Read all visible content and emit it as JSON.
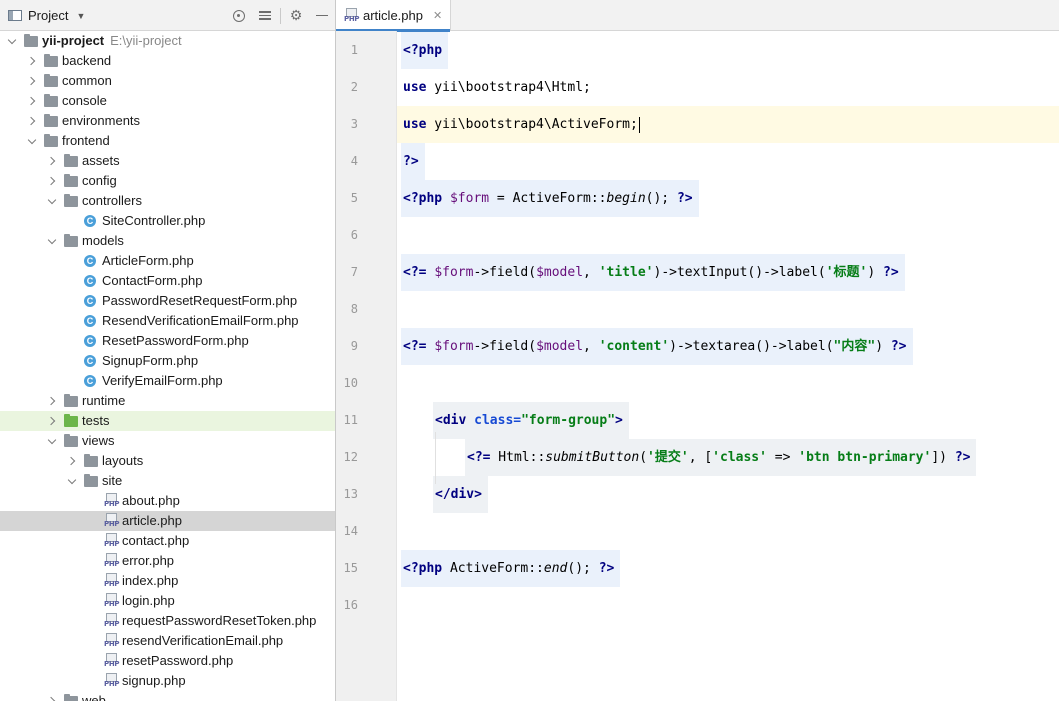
{
  "project_panel": {
    "title": "Project",
    "dropdown_icon": "caret-down-icon",
    "tools": [
      "locate-target-icon",
      "collapse-all-icon",
      "settings-icon",
      "minimize-icon"
    ],
    "tree": [
      {
        "label": "yii-project",
        "path": "E:\\yii-project",
        "kind": "folder",
        "open": true,
        "depth": 0,
        "bold": true
      },
      {
        "label": "backend",
        "kind": "folder",
        "open": false,
        "depth": 1
      },
      {
        "label": "common",
        "kind": "folder",
        "open": false,
        "depth": 1
      },
      {
        "label": "console",
        "kind": "folder",
        "open": false,
        "depth": 1
      },
      {
        "label": "environments",
        "kind": "folder",
        "open": false,
        "depth": 1
      },
      {
        "label": "frontend",
        "kind": "folder",
        "open": true,
        "depth": 1
      },
      {
        "label": "assets",
        "kind": "folder",
        "open": false,
        "depth": 2
      },
      {
        "label": "config",
        "kind": "folder",
        "open": false,
        "depth": 2
      },
      {
        "label": "controllers",
        "kind": "folder",
        "open": true,
        "depth": 2
      },
      {
        "label": "SiteController.php",
        "kind": "class",
        "depth": 3
      },
      {
        "label": "models",
        "kind": "folder",
        "open": true,
        "depth": 2
      },
      {
        "label": "ArticleForm.php",
        "kind": "class",
        "depth": 3
      },
      {
        "label": "ContactForm.php",
        "kind": "class",
        "depth": 3
      },
      {
        "label": "PasswordResetRequestForm.php",
        "kind": "class",
        "depth": 3
      },
      {
        "label": "ResendVerificationEmailForm.php",
        "kind": "class",
        "depth": 3
      },
      {
        "label": "ResetPasswordForm.php",
        "kind": "class",
        "depth": 3
      },
      {
        "label": "SignupForm.php",
        "kind": "class",
        "depth": 3
      },
      {
        "label": "VerifyEmailForm.php",
        "kind": "class",
        "depth": 3
      },
      {
        "label": "runtime",
        "kind": "folder",
        "open": false,
        "depth": 2
      },
      {
        "label": "tests",
        "kind": "folder-green",
        "open": false,
        "depth": 2,
        "highlight": true
      },
      {
        "label": "views",
        "kind": "folder",
        "open": true,
        "depth": 2
      },
      {
        "label": "layouts",
        "kind": "folder",
        "open": false,
        "depth": 3
      },
      {
        "label": "site",
        "kind": "folder",
        "open": true,
        "depth": 3
      },
      {
        "label": "about.php",
        "kind": "php",
        "depth": 4
      },
      {
        "label": "article.php",
        "kind": "php",
        "depth": 4,
        "selected": true
      },
      {
        "label": "contact.php",
        "kind": "php",
        "depth": 4
      },
      {
        "label": "error.php",
        "kind": "php",
        "depth": 4
      },
      {
        "label": "index.php",
        "kind": "php",
        "depth": 4
      },
      {
        "label": "login.php",
        "kind": "php",
        "depth": 4
      },
      {
        "label": "requestPasswordResetToken.php",
        "kind": "php",
        "depth": 4
      },
      {
        "label": "resendVerificationEmail.php",
        "kind": "php",
        "depth": 4
      },
      {
        "label": "resetPassword.php",
        "kind": "php",
        "depth": 4
      },
      {
        "label": "signup.php",
        "kind": "php",
        "depth": 4
      },
      {
        "label": "web",
        "kind": "folder",
        "open": false,
        "depth": 2
      }
    ]
  },
  "editor": {
    "tab": {
      "label": "article.php",
      "icon": "php-file-icon",
      "close": "✕"
    },
    "current_line": 3,
    "lines": [
      {
        "n": "1",
        "tokens": [
          {
            "t": "<?php",
            "c": "tk-kw"
          }
        ]
      },
      {
        "n": "2",
        "tokens": [
          {
            "t": "use",
            "c": "tk-kw"
          },
          {
            "t": " yii\\bootstrap4\\Html;",
            "c": "tk-plain"
          }
        ]
      },
      {
        "n": "3",
        "tokens": [
          {
            "t": "use",
            "c": "tk-kw"
          },
          {
            "t": " yii\\bootstrap4\\ActiveForm;",
            "c": "tk-plain"
          }
        ]
      },
      {
        "n": "4",
        "tokens": [
          {
            "t": "?>",
            "c": "tk-kw"
          }
        ]
      },
      {
        "n": "5",
        "tokens": [
          {
            "t": "<?php",
            "c": "tk-kw"
          },
          {
            "t": " ",
            "c": "tk-plain"
          },
          {
            "t": "$form",
            "c": "tk-var"
          },
          {
            "t": " = ActiveForm::",
            "c": "tk-plain"
          },
          {
            "t": "begin",
            "c": "tk-fn-it"
          },
          {
            "t": "(); ",
            "c": "tk-plain"
          },
          {
            "t": "?>",
            "c": "tk-kw"
          }
        ]
      },
      {
        "n": "6",
        "tokens": []
      },
      {
        "n": "7",
        "tokens": [
          {
            "t": "<?=",
            "c": "tk-kw"
          },
          {
            "t": " ",
            "c": "tk-plain"
          },
          {
            "t": "$form",
            "c": "tk-var"
          },
          {
            "t": "->field(",
            "c": "tk-plain"
          },
          {
            "t": "$model",
            "c": "tk-var"
          },
          {
            "t": ", ",
            "c": "tk-plain"
          },
          {
            "t": "'title'",
            "c": "tk-str"
          },
          {
            "t": ")->textInput()->label(",
            "c": "tk-plain"
          },
          {
            "t": "'标题'",
            "c": "tk-str"
          },
          {
            "t": ") ",
            "c": "tk-plain"
          },
          {
            "t": "?>",
            "c": "tk-kw"
          }
        ]
      },
      {
        "n": "8",
        "tokens": []
      },
      {
        "n": "9",
        "tokens": [
          {
            "t": "<?=",
            "c": "tk-kw"
          },
          {
            "t": " ",
            "c": "tk-plain"
          },
          {
            "t": "$form",
            "c": "tk-var"
          },
          {
            "t": "->field(",
            "c": "tk-plain"
          },
          {
            "t": "$model",
            "c": "tk-var"
          },
          {
            "t": ", ",
            "c": "tk-plain"
          },
          {
            "t": "'content'",
            "c": "tk-str"
          },
          {
            "t": ")->textarea()->label(",
            "c": "tk-plain"
          },
          {
            "t": "\"内容\"",
            "c": "tk-str"
          },
          {
            "t": ") ",
            "c": "tk-plain"
          },
          {
            "t": "?>",
            "c": "tk-kw"
          }
        ]
      },
      {
        "n": "10",
        "tokens": []
      },
      {
        "n": "11",
        "indent": 1,
        "tokens": [
          {
            "t": "<div",
            "c": "tk-tag"
          },
          {
            "t": " ",
            "c": "tk-plain"
          },
          {
            "t": "class=",
            "c": "tk-attr"
          },
          {
            "t": "\"form-group\"",
            "c": "tk-attrv"
          },
          {
            "t": ">",
            "c": "tk-tag"
          }
        ]
      },
      {
        "n": "12",
        "indent": 2,
        "tokens": [
          {
            "t": "<?=",
            "c": "tk-kw"
          },
          {
            "t": " Html::",
            "c": "tk-plain"
          },
          {
            "t": "submitButton",
            "c": "tk-fn-it"
          },
          {
            "t": "(",
            "c": "tk-plain"
          },
          {
            "t": "'提交'",
            "c": "tk-str"
          },
          {
            "t": ", [",
            "c": "tk-plain"
          },
          {
            "t": "'class'",
            "c": "tk-str"
          },
          {
            "t": " => ",
            "c": "tk-plain"
          },
          {
            "t": "'btn btn-primary'",
            "c": "tk-str"
          },
          {
            "t": "]) ",
            "c": "tk-plain"
          },
          {
            "t": "?>",
            "c": "tk-kw"
          }
        ]
      },
      {
        "n": "13",
        "indent": 1,
        "tokens": [
          {
            "t": "</div>",
            "c": "tk-tag"
          }
        ]
      },
      {
        "n": "14",
        "tokens": []
      },
      {
        "n": "15",
        "tokens": [
          {
            "t": "<?php",
            "c": "tk-kw"
          },
          {
            "t": " ActiveForm::",
            "c": "tk-plain"
          },
          {
            "t": "end",
            "c": "tk-fn-it"
          },
          {
            "t": "(); ",
            "c": "tk-plain"
          },
          {
            "t": "?>",
            "c": "tk-kw"
          }
        ]
      },
      {
        "n": "16",
        "tokens": []
      }
    ]
  }
}
